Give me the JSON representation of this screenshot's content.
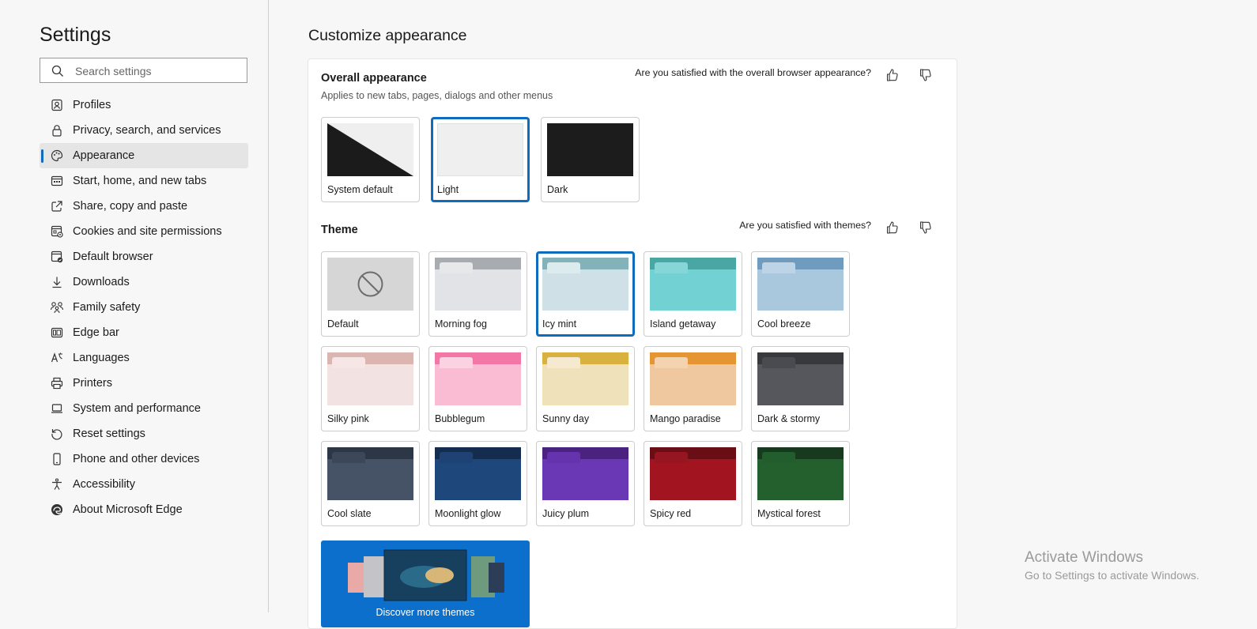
{
  "sidebar": {
    "title": "Settings",
    "search_placeholder": "Search settings",
    "items": [
      {
        "label": "Profiles",
        "icon": "profile-icon"
      },
      {
        "label": "Privacy, search, and services",
        "icon": "lock-icon"
      },
      {
        "label": "Appearance",
        "icon": "palette-icon",
        "active": true
      },
      {
        "label": "Start, home, and new tabs",
        "icon": "start-tabs-icon"
      },
      {
        "label": "Share, copy and paste",
        "icon": "share-icon"
      },
      {
        "label": "Cookies and site permissions",
        "icon": "cookies-icon"
      },
      {
        "label": "Default browser",
        "icon": "browser-icon"
      },
      {
        "label": "Downloads",
        "icon": "download-icon"
      },
      {
        "label": "Family safety",
        "icon": "family-icon"
      },
      {
        "label": "Edge bar",
        "icon": "edge-bar-icon"
      },
      {
        "label": "Languages",
        "icon": "language-icon"
      },
      {
        "label": "Printers",
        "icon": "printer-icon"
      },
      {
        "label": "System and performance",
        "icon": "laptop-icon"
      },
      {
        "label": "Reset settings",
        "icon": "reset-icon"
      },
      {
        "label": "Phone and other devices",
        "icon": "phone-icon"
      },
      {
        "label": "Accessibility",
        "icon": "accessibility-icon"
      },
      {
        "label": "About Microsoft Edge",
        "icon": "edge-logo-icon"
      }
    ]
  },
  "main": {
    "title": "Customize appearance",
    "overall": {
      "title": "Overall appearance",
      "subtitle": "Applies to new tabs, pages, dialogs and other menus",
      "feedback_question": "Are you satisfied with the overall browser appearance?",
      "options": [
        {
          "label": "System default",
          "selected": false
        },
        {
          "label": "Light",
          "selected": true
        },
        {
          "label": "Dark",
          "selected": false
        }
      ]
    },
    "theme": {
      "title": "Theme",
      "feedback_question": "Are you satisfied with themes?",
      "items": [
        {
          "label": "Default",
          "selected": false,
          "colors": {
            "bar": "#d6d6d6",
            "tab": "#d6d6d6",
            "body": "#d6d6d6"
          }
        },
        {
          "label": "Morning fog",
          "selected": false,
          "colors": {
            "bar": "#a8abb0",
            "tab": "#e7e8ea",
            "body": "#e2e3e6"
          }
        },
        {
          "label": "Icy mint",
          "selected": true,
          "colors": {
            "bar": "#83b3b8",
            "tab": "#dcebee",
            "body": "#cfe1e6"
          }
        },
        {
          "label": "Island getaway",
          "selected": false,
          "colors": {
            "bar": "#4aa6a3",
            "tab": "#86d6d7",
            "body": "#72d1d2"
          }
        },
        {
          "label": "Cool breeze",
          "selected": false,
          "colors": {
            "bar": "#6f9cbe",
            "tab": "#bcd4e6",
            "body": "#a9c7dd"
          }
        },
        {
          "label": "Silky pink",
          "selected": false,
          "colors": {
            "bar": "#dbb6b0",
            "tab": "#f6e7e6",
            "body": "#f2e2e1"
          }
        },
        {
          "label": "Bubblegum",
          "selected": false,
          "colors": {
            "bar": "#f277a7",
            "tab": "#fbd2e2",
            "body": "#f9bcd3"
          }
        },
        {
          "label": "Sunny day",
          "selected": false,
          "colors": {
            "bar": "#d8b13e",
            "tab": "#f5ead0",
            "body": "#efe1b9"
          }
        },
        {
          "label": "Mango paradise",
          "selected": false,
          "colors": {
            "bar": "#e69535",
            "tab": "#f4d3b1",
            "body": "#f0c89f"
          }
        },
        {
          "label": "Dark & stormy",
          "selected": false,
          "colors": {
            "bar": "#38393d",
            "tab": "#4a4b50",
            "body": "#56575d"
          }
        },
        {
          "label": "Cool slate",
          "selected": false,
          "colors": {
            "bar": "#2d3645",
            "tab": "#3c475a",
            "body": "#465366"
          }
        },
        {
          "label": "Moonlight glow",
          "selected": false,
          "colors": {
            "bar": "#142d4f",
            "tab": "#1d4273",
            "body": "#1e477c"
          }
        },
        {
          "label": "Juicy plum",
          "selected": false,
          "colors": {
            "bar": "#4a2380",
            "tab": "#6533ad",
            "body": "#6a37b5"
          }
        },
        {
          "label": "Spicy red",
          "selected": false,
          "colors": {
            "bar": "#6a0e15",
            "tab": "#951520",
            "body": "#a2141f"
          }
        },
        {
          "label": "Mystical forest",
          "selected": false,
          "colors": {
            "bar": "#173a1e",
            "tab": "#225e2d",
            "body": "#23602e"
          }
        }
      ],
      "discover_label": "Discover more themes"
    }
  },
  "watermark": {
    "title": "Activate Windows",
    "subtitle": "Go to Settings to activate Windows."
  },
  "colors": {
    "accent": "#0f6cbd",
    "discover_bg": "#0c6fcb"
  }
}
